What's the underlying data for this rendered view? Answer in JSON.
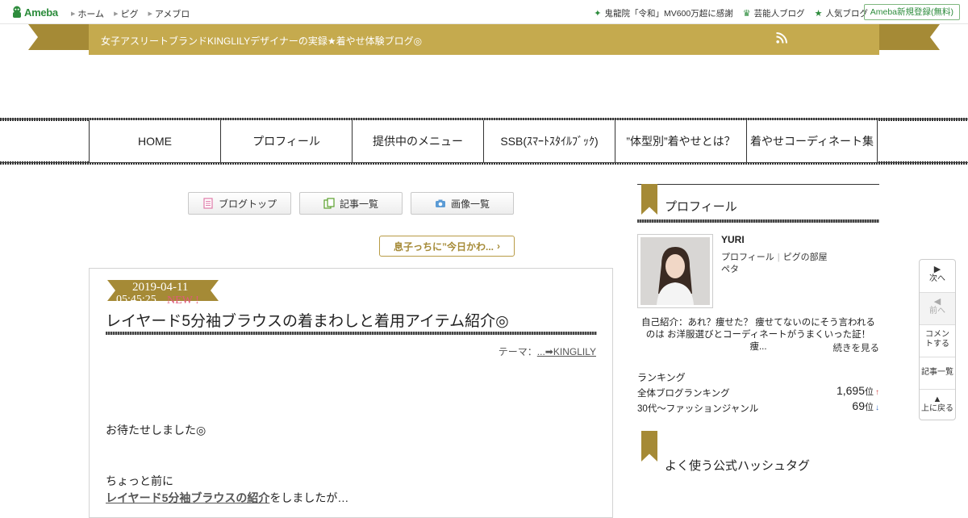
{
  "topbar": {
    "logo": "Ameba",
    "nav": [
      "ホーム",
      "ピグ",
      "アメブロ"
    ],
    "links": [
      "鬼龍院「令和」MV600万超に感謝",
      "芸能人ブログ",
      "人気ブログ"
    ],
    "register": "Ameba新規登録(無料)"
  },
  "blog": {
    "title": "女子アスリートブランドKINGLILYデザイナーの実録★着やせ体験ブログ◎"
  },
  "globalnav": [
    "HOME",
    "プロフィール",
    "提供中のメニュー",
    "SSB(ｽﾏｰﾄｽﾀｲﾙﾌﾞｯｸ)",
    "”体型別”着やせとは？",
    "着やせコーディネート集"
  ],
  "blogbuttons": [
    "ブログトップ",
    "記事一覧",
    "画像一覧"
  ],
  "prevpost": "息子っちに”今日かわ...",
  "article": {
    "date": "2019-04-11",
    "time": "05:45:25",
    "new": "NEW !",
    "title": "レイヤード5分袖ブラウスの着まわしと着用アイテム紹介◎",
    "theme_label": "テーマ：",
    "theme": "...➡KINGLILY",
    "p1": "お待たせしました◎",
    "p2": "ちょっと前に",
    "p3_link": "レイヤード5分袖ブラウスの紹介",
    "p3_rest": "をしましたが…"
  },
  "sidebar": {
    "profile_heading": "プロフィール",
    "name": "YURI",
    "link1": "プロフィール",
    "link2": "ピグの部屋",
    "peta": "ペタ",
    "intro": "自己紹介：あれ？痩せた？ 痩せてないのにそう言われるのは お洋服選びとコーディネートがうまくいった証！ 痩...",
    "more": "続きを見る",
    "ranking_title": "ランキング",
    "rankings": [
      {
        "label": "全体ブログランキング",
        "value": "1,695",
        "unit": "位",
        "trend": "↑"
      },
      {
        "label": "30代〜ファッションジャンル",
        "value": "69",
        "unit": "位",
        "trend": "↓"
      }
    ],
    "hashtag_heading": "よく使う公式ハッシュタグ"
  },
  "floatmenu": {
    "next": "次へ",
    "prev": "前へ",
    "comment": "コメントする",
    "list": "記事一覧",
    "top": "上に戻る"
  },
  "colors": {
    "gold": "#c5aa4e",
    "gold_dark": "#a58a36",
    "ameba_green": "#2d8c3c",
    "new_pink": "#e05a7b"
  }
}
